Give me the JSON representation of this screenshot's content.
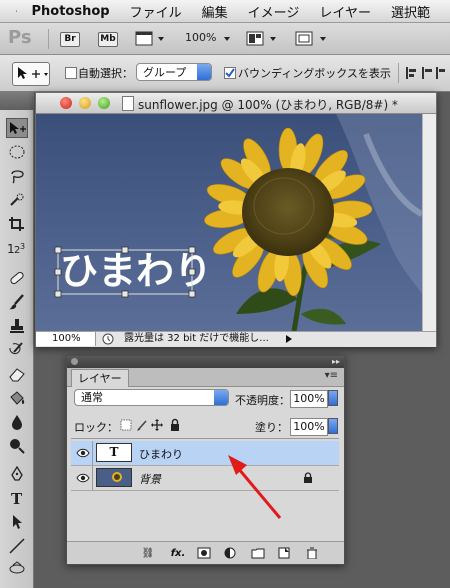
{
  "menubar": {
    "app_name": "Photoshop",
    "items": [
      "ファイル",
      "編集",
      "イメージ",
      "レイヤー",
      "選択範"
    ]
  },
  "appbar": {
    "logo": "Ps",
    "bridge": "Br",
    "minibridge": "Mb",
    "zoom": "100%"
  },
  "options": {
    "auto_select_label": "自動選択：",
    "auto_select_value": "グループ",
    "bbox_label": "バウンディングボックスを表示"
  },
  "document": {
    "title": "sunflower.jpg @ 100% (ひまわり, RGB/8#) *",
    "text_layer_content": "ひまわり",
    "zoom": "100%",
    "status": "露光量は 32 bit だけで機能し..."
  },
  "layers_panel": {
    "tab": "レイヤー",
    "blend_mode": "通常",
    "opacity_label": "不透明度：",
    "opacity": "100%",
    "lock_label": "ロック：",
    "fill_label": "塗り：",
    "fill": "100%",
    "text_thumb": "T",
    "layers": [
      {
        "name": "ひまわり"
      },
      {
        "name": "背景"
      }
    ]
  },
  "colors": {
    "sky": "#4a5f88",
    "petal": "#e8b826",
    "seed": "#5a4a1e",
    "selection": "#b8d3f4",
    "arrow": "#e11a1a"
  }
}
